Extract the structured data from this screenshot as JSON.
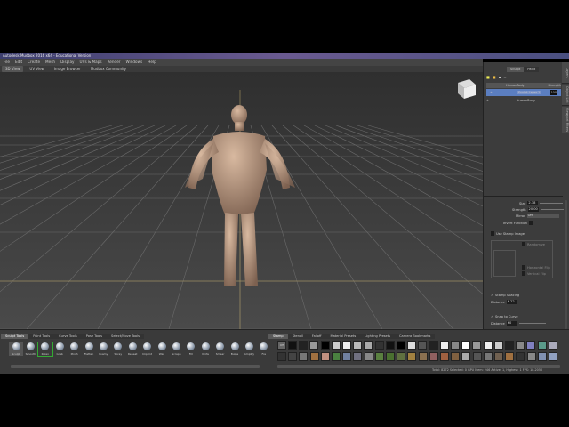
{
  "window": {
    "title": "Autodesk Mudbox 2016 x64 - Educational Version"
  },
  "menu": [
    "File",
    "Edit",
    "Create",
    "Mesh",
    "Display",
    "UVs & Maps",
    "Render",
    "Windows",
    "Help"
  ],
  "view_tabs": [
    {
      "label": "3D View",
      "active": true
    },
    {
      "label": "UV View"
    },
    {
      "label": "Image Browser"
    },
    {
      "label": "Mudbox Community"
    }
  ],
  "viewcube": {
    "face": "FRONT"
  },
  "right_panel": {
    "tabs": [
      "Sculpt",
      "Paint"
    ],
    "active_tab": "Sculpt",
    "layer_header": {
      "name_col": "HumanBody",
      "strength_col": "Strength"
    },
    "layers": [
      {
        "name": "Sculpt Layer 1",
        "strength": "100",
        "selected": true
      }
    ],
    "objects": [
      {
        "name": "HumanBody"
      }
    ],
    "side_tabs": [
      "Layers",
      "Object List",
      "Viewport Filters"
    ],
    "properties": {
      "size_label": "Size",
      "size": "2.38",
      "strength_label": "Strength",
      "strength": "20.00",
      "mirror_label": "Mirror",
      "mirror": "Off",
      "invert_label": "Invert Function",
      "stamp_label": "Use Stamp Image",
      "randomize_label": "Randomize",
      "hflip_label": "Horizontal Flip",
      "vflip_label": "Vertical Flip",
      "spacing_label": "Stamp Spacing",
      "spacing_distance_label": "Distance",
      "spacing_distance": "6.22",
      "snap_label": "Snap to Curve",
      "snap_distance_label": "Distance",
      "snap_distance": "60"
    }
  },
  "tool_tray": {
    "tabs": [
      "Sculpt Tools",
      "Paint Tools",
      "Curve Tools",
      "Pose Tools",
      "Select/Move Tools"
    ],
    "active_tab": "Sculpt Tools",
    "tools": [
      "Sculpt",
      "Smooth",
      "Relax",
      "Grab",
      "Pinch",
      "Flatten",
      "Foamy",
      "Spray",
      "Repeat",
      "Imprint",
      "Wax",
      "Scrape",
      "Fill",
      "Knife",
      "Smear",
      "Bulge",
      "Amplify",
      "Fre"
    ],
    "selected_tool": "Relax"
  },
  "stamp_tray": {
    "tabs": [
      "Stamp",
      "Stencil",
      "Falloff",
      "Material Presets",
      "Lighting Presets",
      "Camera Bookmarks"
    ],
    "active_tab": "Stamp",
    "off_label": "Off"
  },
  "status": "Total: 8272  Selected: 0  GPU Mem: 246  Active: 1, Highest: 1  FPS: 18.2050"
}
